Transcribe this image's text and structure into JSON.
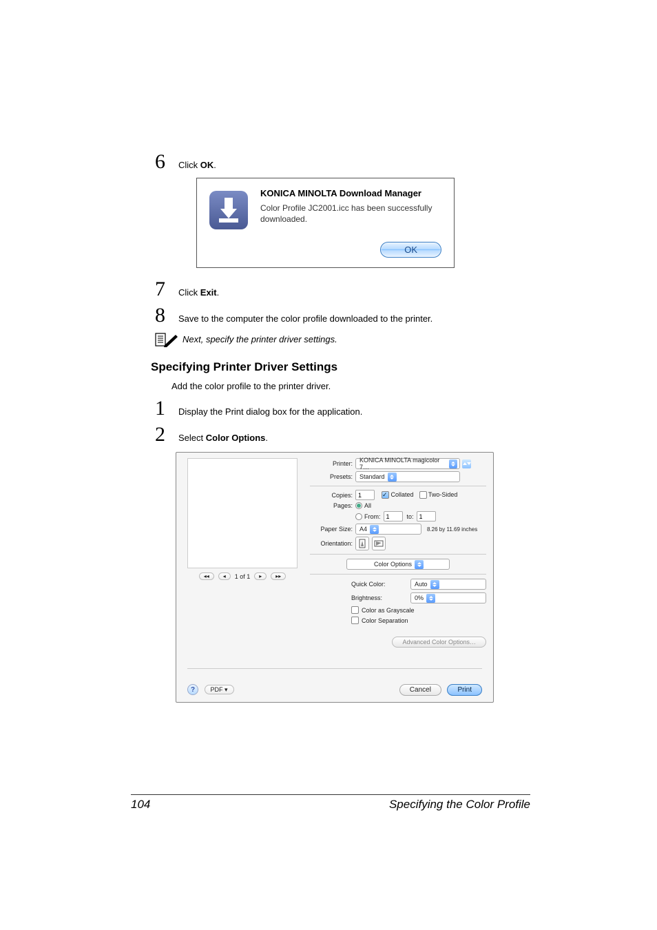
{
  "steps": {
    "s6": {
      "num": "6",
      "pre": "Click ",
      "bold": "OK",
      "post": "."
    },
    "s7": {
      "num": "7",
      "pre": "Click ",
      "bold": "Exit",
      "post": "."
    },
    "s8": {
      "num": "8",
      "text": "Save to the computer the color profile downloaded to the printer."
    }
  },
  "dialog1": {
    "title": "KONICA MINOLTA Download Manager",
    "message": "Color Profile JC2001.icc has been successfully downloaded.",
    "ok": "OK"
  },
  "note": "Next, specify the printer driver settings.",
  "section_heading": "Specifying Printer Driver Settings",
  "intro": "Add the color profile to the printer driver.",
  "steps2": {
    "s1": {
      "num": "1",
      "text": "Display the Print dialog box for the application."
    },
    "s2": {
      "num": "2",
      "pre": "Select ",
      "bold": "Color Options",
      "post": "."
    }
  },
  "print_dialog": {
    "labels": {
      "printer": "Printer:",
      "presets": "Presets:",
      "copies": "Copies:",
      "pages": "Pages:",
      "from": "From:",
      "to": "to:",
      "paper_size": "Paper Size:",
      "orientation": "Orientation:"
    },
    "values": {
      "printer": "KONICA MINOLTA magicolor 7…",
      "presets": "Standard",
      "copies": "1",
      "collated": "Collated",
      "two_sided": "Two-Sided",
      "pages_all": "All",
      "from": "1",
      "to": "1",
      "paper_size": "A4",
      "paper_size_note": "8.26 by 11.69 inches",
      "panel": "Color Options"
    },
    "options": {
      "quick_color_label": "Quick Color:",
      "quick_color_value": "Auto",
      "brightness_label": "Brightness:",
      "brightness_value": "0%",
      "grayscale": "Color as Grayscale",
      "separation": "Color Separation",
      "advanced": "Advanced Color Options…"
    },
    "preview_nav": {
      "page": "1 of 1"
    },
    "bottom": {
      "pdf": "PDF ▾",
      "cancel": "Cancel",
      "print": "Print"
    }
  },
  "footer": {
    "page": "104",
    "title": "Specifying the Color Profile"
  }
}
